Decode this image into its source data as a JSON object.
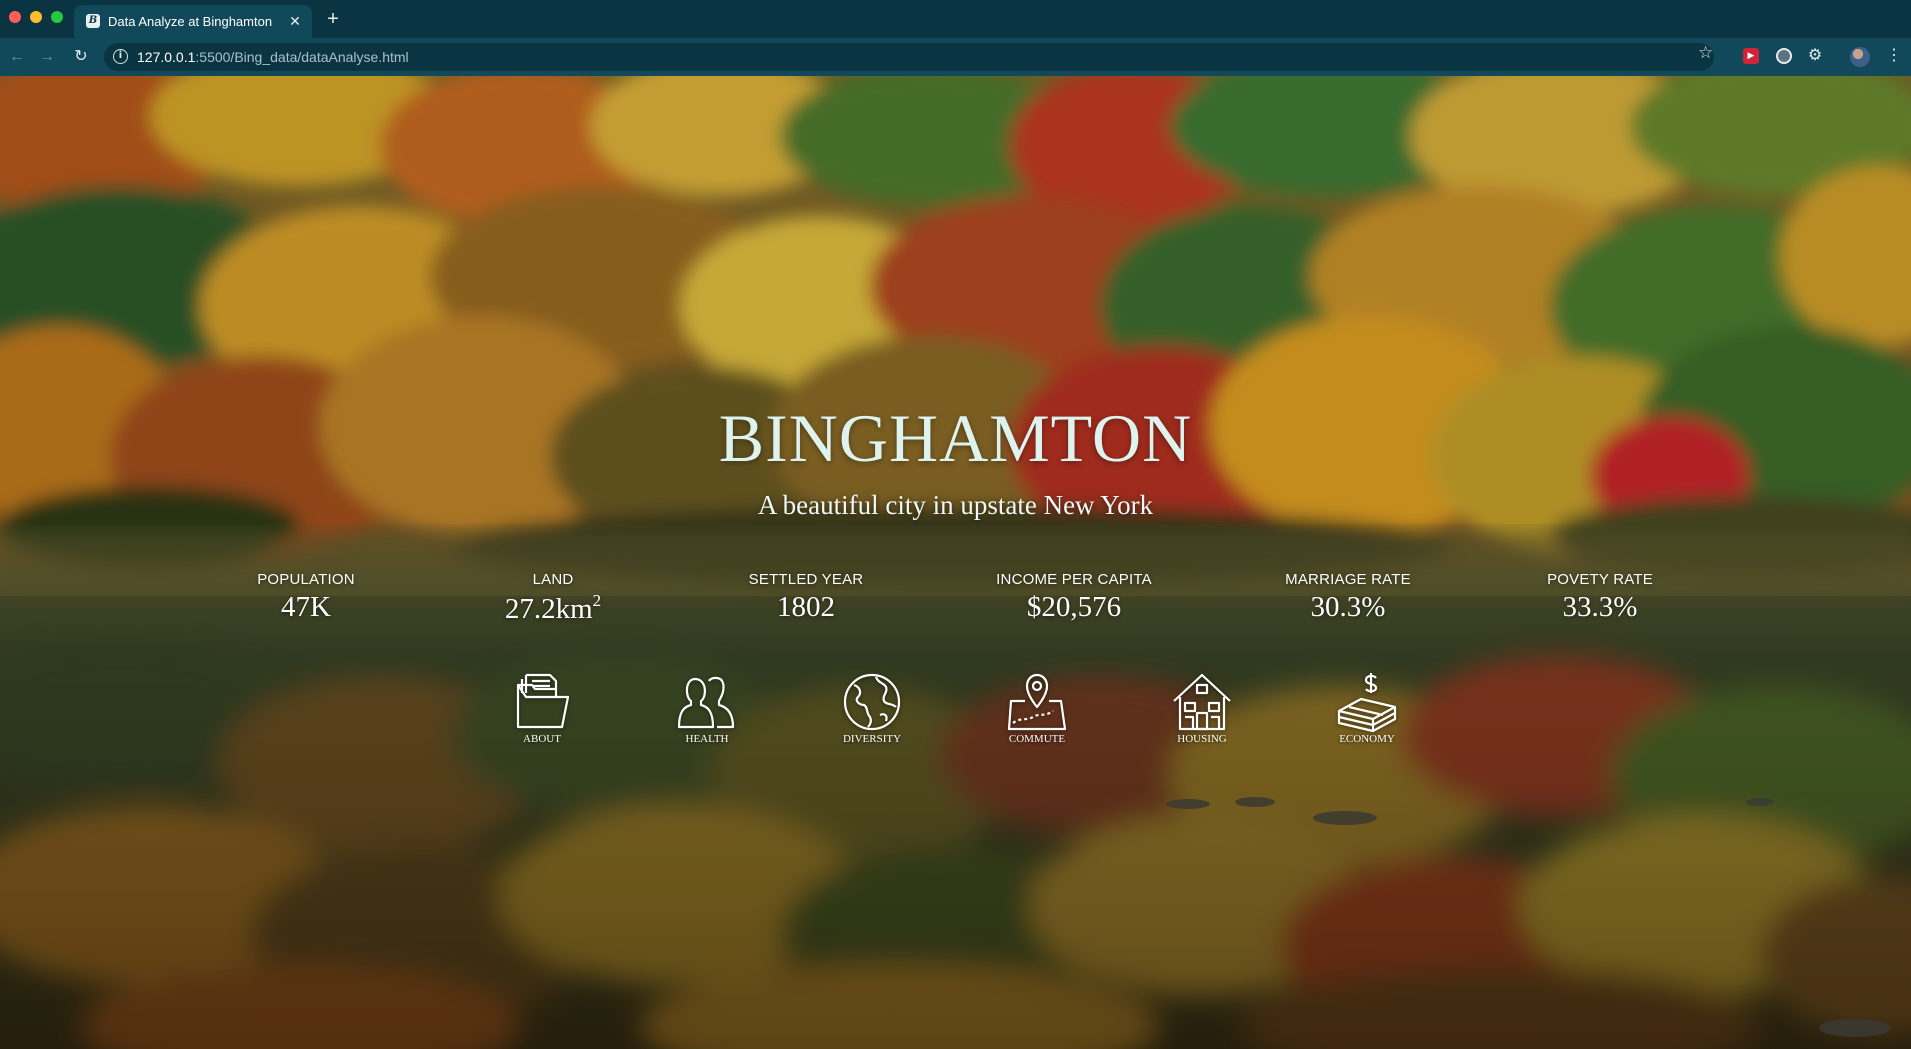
{
  "browser": {
    "tab_title": "Data Analyze at Binghamton",
    "tab_favicon_letter": "B",
    "url_host": "127.0.0.1",
    "url_rest": ":5500/Bing_data/dataAnalyse.html",
    "extension_label": "▶"
  },
  "hero": {
    "title": "BINGHAMTON",
    "subtitle": "A beautiful city in upstate New York"
  },
  "stats": [
    {
      "label": "POPULATION",
      "value": "47K"
    },
    {
      "label": "LAND",
      "value": "27.2km",
      "sup": "2"
    },
    {
      "label": "SETTLED YEAR",
      "value": "1802"
    },
    {
      "label": "INCOME PER CAPITA",
      "value": "$20,576"
    },
    {
      "label": "MARRIAGE RATE",
      "value": "30.3%"
    },
    {
      "label": "POVETY RATE",
      "value": "33.3%"
    }
  ],
  "nav": [
    {
      "label": "ABOUT",
      "icon": "folder-icon"
    },
    {
      "label": "HEALTH",
      "icon": "people-icon"
    },
    {
      "label": "DIVERSITY",
      "icon": "globe-icon"
    },
    {
      "label": "COMMUTE",
      "icon": "map-pin-icon"
    },
    {
      "label": "HOUSING",
      "icon": "house-icon"
    },
    {
      "label": "ECONOMY",
      "icon": "money-icon"
    }
  ],
  "colors": {
    "chrome_dark": "#0b3442",
    "chrome_toolbar": "#11485a",
    "title_text": "#def3ee"
  }
}
